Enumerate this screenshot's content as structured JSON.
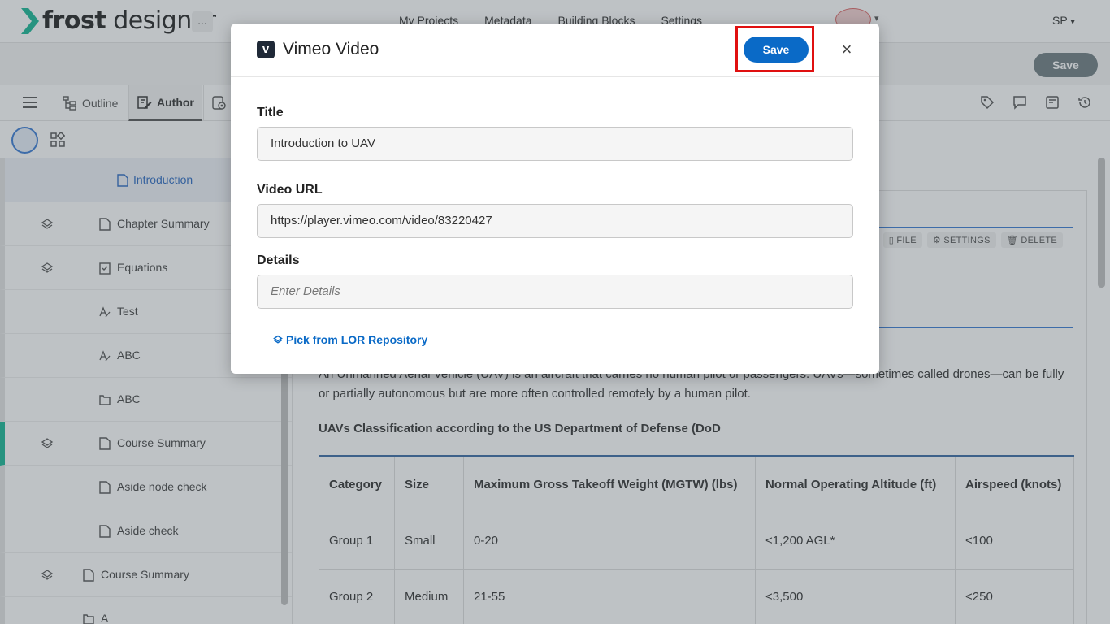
{
  "app": {
    "brand_bold": "frost",
    "brand_light": " designer",
    "more_label": "...",
    "nav": [
      "My Projects",
      "Metadata",
      "Building Blocks",
      "Settings"
    ],
    "user_initials": "SP",
    "user_caret": "▾",
    "org_caret": "▾"
  },
  "background_save_label": "Save",
  "tabs": {
    "outline": "Outline",
    "author": "Author"
  },
  "sidebar": {
    "items": [
      {
        "label": "Introduction"
      },
      {
        "label": "Chapter Summary"
      },
      {
        "label": "Equations"
      },
      {
        "label": "Test"
      },
      {
        "label": "ABC"
      },
      {
        "label": "ABC"
      },
      {
        "label": "Course Summary"
      },
      {
        "label": "Aside node check"
      },
      {
        "label": "Aside check"
      },
      {
        "label": "Course Summary"
      },
      {
        "label": "A"
      }
    ]
  },
  "content": {
    "widget_tools": [
      "FILE",
      "SETTINGS",
      "DELETE"
    ],
    "paragraph": "An Unmanned Aerial Vehicle (UAV) is an aircraft that carries no human pilot or passengers. UAVs—sometimes called drones—can be fully or partially autonomous but are more often controlled remotely by a human pilot.",
    "subheading": "UAVs Classification according to the US Department of Defense (DoD",
    "table": {
      "headers": [
        "Category",
        "Size",
        "Maximum Gross Takeoff Weight (MGTW) (lbs)",
        "Normal Operating Altitude (ft)",
        "Airspeed (knots)"
      ],
      "rows": [
        [
          "Group 1",
          "Small",
          "0-20",
          "<1,200 AGL*",
          "<100"
        ],
        [
          "Group 2",
          "Medium",
          "21-55",
          "<3,500",
          "<250"
        ]
      ]
    }
  },
  "modal": {
    "title": "Vimeo Video",
    "icon_letter": "v",
    "save_label": "Save",
    "close_label": "×",
    "title_label": "Title",
    "title_value": "Introduction to UAV",
    "url_label": "Video URL",
    "url_value": "https://player.vimeo.com/video/83220427",
    "details_label": "Details",
    "details_placeholder": "Enter Details",
    "lor_link": "Pick from LOR Repository"
  },
  "colors": {
    "primary": "#0a6ac7",
    "highlight": "#e01010",
    "accent_green": "#18b795"
  }
}
